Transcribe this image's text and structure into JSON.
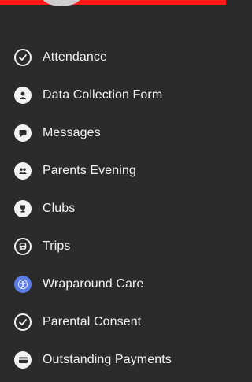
{
  "menu": {
    "items": [
      {
        "label": "Attendance",
        "icon": "check-circle-icon"
      },
      {
        "label": "Data Collection Form",
        "icon": "user-circle-icon"
      },
      {
        "label": "Messages",
        "icon": "chat-bubble-icon"
      },
      {
        "label": "Parents Evening",
        "icon": "people-icon"
      },
      {
        "label": "Clubs",
        "icon": "trophy-icon"
      },
      {
        "label": "Trips",
        "icon": "bus-icon"
      },
      {
        "label": "Wraparound Care",
        "icon": "accessibility-icon",
        "accent": "#5b7be6"
      },
      {
        "label": "Parental Consent",
        "icon": "check-circle-icon"
      },
      {
        "label": "Outstanding Payments",
        "icon": "card-icon"
      }
    ]
  },
  "colors": {
    "background": "#2b2b2b",
    "text": "#f2f2f2",
    "highlight": "#5b7be6",
    "top_bar": "#ff1a1a"
  }
}
